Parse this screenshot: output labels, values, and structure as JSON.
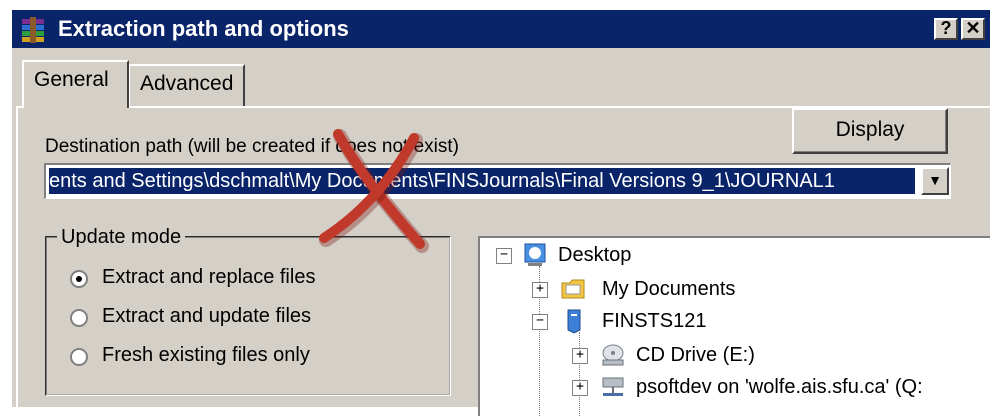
{
  "window": {
    "title": "Extraction path and options",
    "help_label": "?",
    "close_label": "✕"
  },
  "tabs": [
    {
      "label": "General",
      "selected": true
    },
    {
      "label": "Advanced",
      "selected": false
    }
  ],
  "destination": {
    "label": "Destination path (will be created if does not exist)",
    "value": "ents and Settings\\dschmalt\\My Documents\\FINSJournals\\Final Versions 9_1\\JOURNAL1",
    "display_button": "Display"
  },
  "update_mode": {
    "legend": "Update mode",
    "options": [
      {
        "label": "Extract and replace files",
        "checked": true
      },
      {
        "label": "Extract and update files",
        "checked": false
      },
      {
        "label": "Fresh existing files only",
        "checked": false
      }
    ]
  },
  "tree": {
    "items": [
      {
        "label": "Desktop",
        "icon": "desktop-icon",
        "expander": "−"
      },
      {
        "label": "My Documents",
        "icon": "folder-icon",
        "expander": "+"
      },
      {
        "label": "FINSTS121",
        "icon": "computer-icon",
        "expander": "−"
      },
      {
        "label": "CD Drive (E:)",
        "icon": "cd-drive-icon",
        "expander": "+"
      },
      {
        "label": "psoftdev on 'wolfe.ais.sfu.ca' (Q:",
        "icon": "network-drive-icon",
        "expander": "+"
      }
    ]
  },
  "colors": {
    "titlebar": "#0a246a",
    "face": "#d4d0c8",
    "selection": "#0a246a",
    "overlay_x": "#c0392b"
  }
}
